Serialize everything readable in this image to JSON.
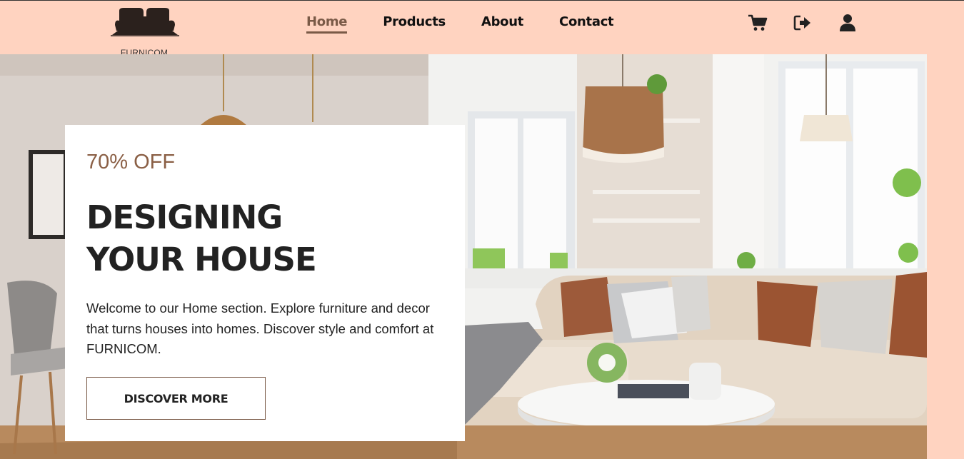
{
  "brand": {
    "name": "FURNICOM"
  },
  "nav": {
    "items": [
      {
        "label": "Home",
        "active": true
      },
      {
        "label": "Products",
        "active": false
      },
      {
        "label": "About",
        "active": false
      },
      {
        "label": "Contact",
        "active": false
      }
    ]
  },
  "header_icons": [
    "cart-icon",
    "logout-icon",
    "user-icon"
  ],
  "hero": {
    "offer": "70% OFF",
    "headline_line1": "DESIGNING",
    "headline_line2": "YOUR HOUSE",
    "description": "Welcome to our Home section. Explore furniture and decor that turns houses into homes. Discover style and comfort at FURNICOM.",
    "cta_label": "DISCOVER MORE"
  },
  "colors": {
    "header_bg": "#ffd3c0",
    "accent": "#7a5a47",
    "offer_text": "#8a5f45",
    "heading_text": "#222222"
  }
}
